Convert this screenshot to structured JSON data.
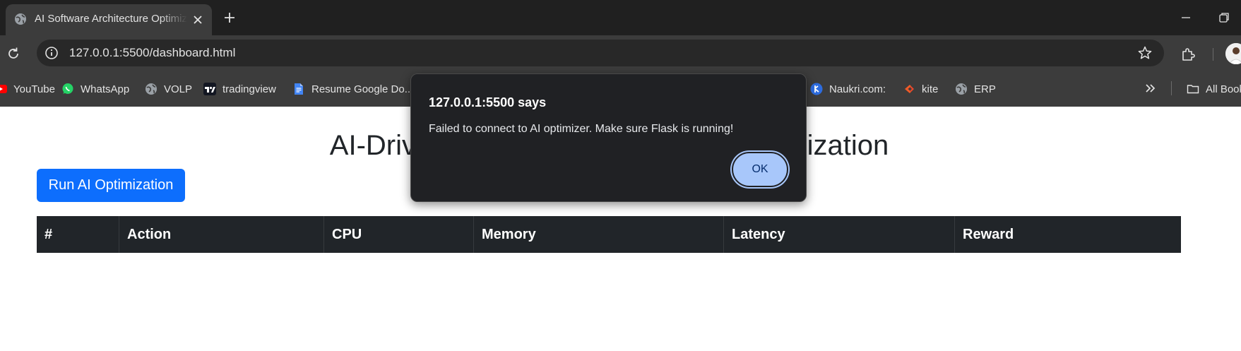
{
  "browser": {
    "tab": {
      "title": "AI Software Architecture Optimization Dashboard"
    },
    "address_bar": {
      "url": "127.0.0.1:5500/dashboard.html"
    },
    "bookmarks": [
      {
        "label": "YouTube",
        "icon": "youtube-icon"
      },
      {
        "label": "WhatsApp",
        "icon": "whatsapp-icon"
      },
      {
        "label": "VOLP",
        "icon": "globe-icon"
      },
      {
        "label": "tradingview",
        "icon": "tradingview-icon"
      },
      {
        "label": "Resume Google Do...",
        "icon": "google-docs-icon"
      },
      {
        "label": "Naukri.com:",
        "icon": "naukri-icon"
      },
      {
        "label": "kite",
        "icon": "kite-icon"
      },
      {
        "label": "ERP",
        "icon": "globe-icon"
      }
    ],
    "all_bookmarks_label": "All Bookmarks"
  },
  "page": {
    "title": "AI-Driven Software Architecture Optimization",
    "run_button_label": "Run AI Optimization",
    "table": {
      "headers": [
        "#",
        "Action",
        "CPU",
        "Memory",
        "Latency",
        "Reward"
      ],
      "rows": []
    }
  },
  "dialog": {
    "title": "127.0.0.1:5500 says",
    "message": "Failed to connect to AI optimizer. Make sure Flask is running!",
    "ok_label": "OK"
  },
  "colors": {
    "primary_button": "#0d6efd",
    "table_header_bg": "#212529",
    "dialog_bg": "#202124",
    "dialog_ok_bg": "#a8c7fa",
    "browser_chrome": "#3c3c3c"
  }
}
